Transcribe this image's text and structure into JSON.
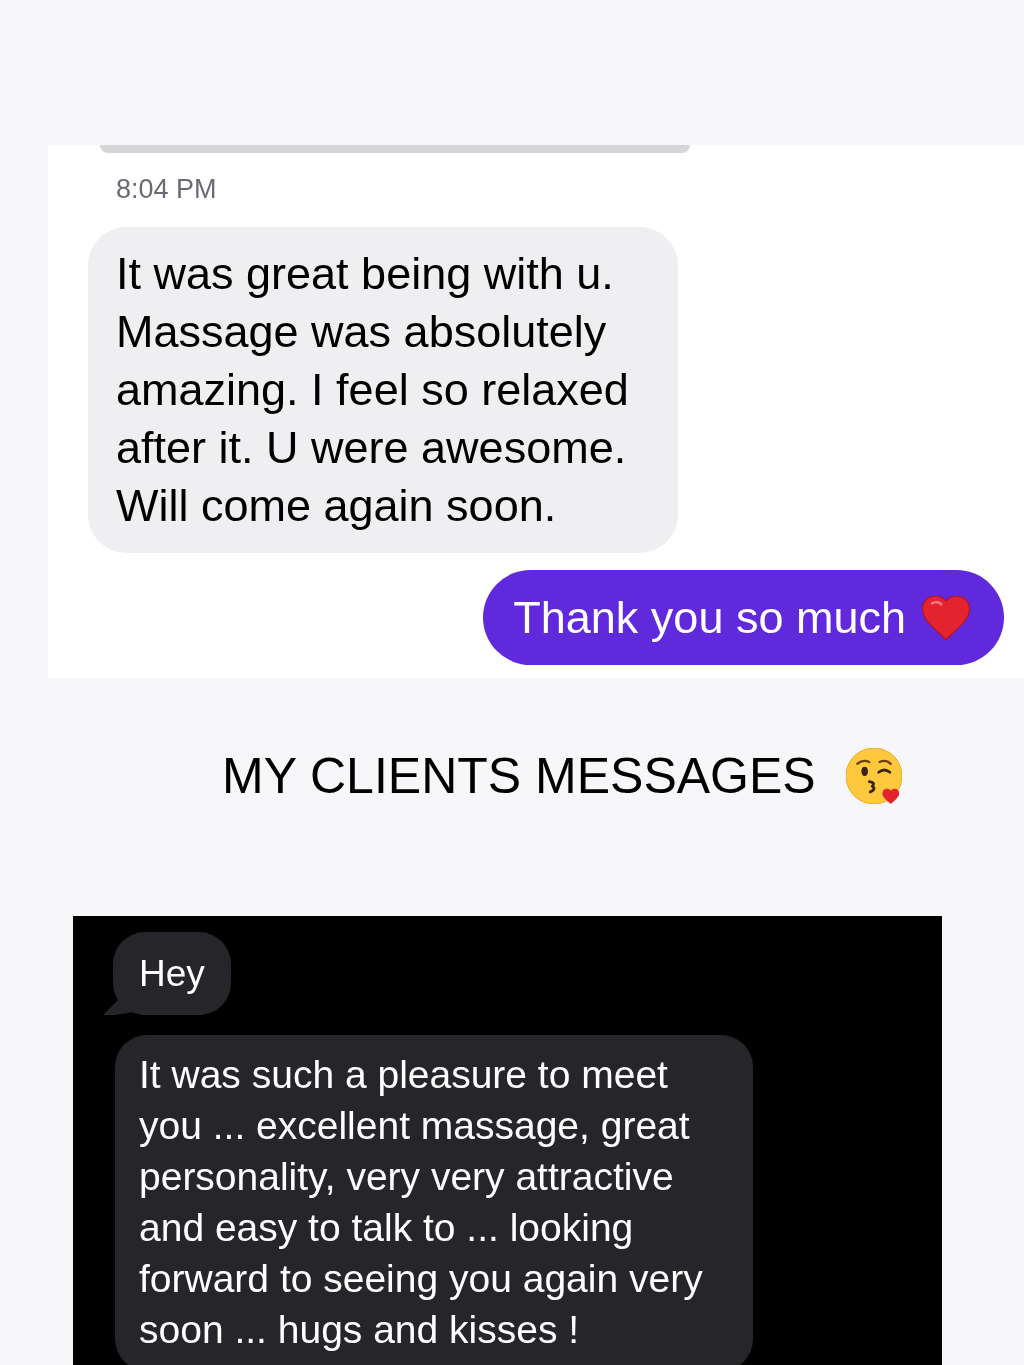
{
  "light_chat": {
    "items": [
      {
        "kind": "bubble_edge"
      },
      {
        "kind": "timestamp",
        "text": "8:04 PM"
      },
      {
        "kind": "message",
        "sent": false,
        "text": "It was great being with u.\nMassage was absolutely\namazing. I feel so relaxed\nafter it. U were awesome.\nWill come again soon."
      },
      {
        "kind": "message",
        "sent": true,
        "text": "Thank you so much",
        "trailing_icon": true
      }
    ]
  },
  "heading": {
    "text": "MY CLIENTS MESSAGES"
  },
  "dark_chat": {
    "messages": [
      {
        "sent": false,
        "tail": true,
        "text": "Hey"
      },
      {
        "sent": false,
        "tail": false,
        "text": "It was such a pleasure to meet\nyou ... excellent massage, great\npersonality, very very attractive\nand easy to talk to ... looking\nforward to seeing you again very\nsoon ... hugs and kisses !"
      }
    ]
  }
}
